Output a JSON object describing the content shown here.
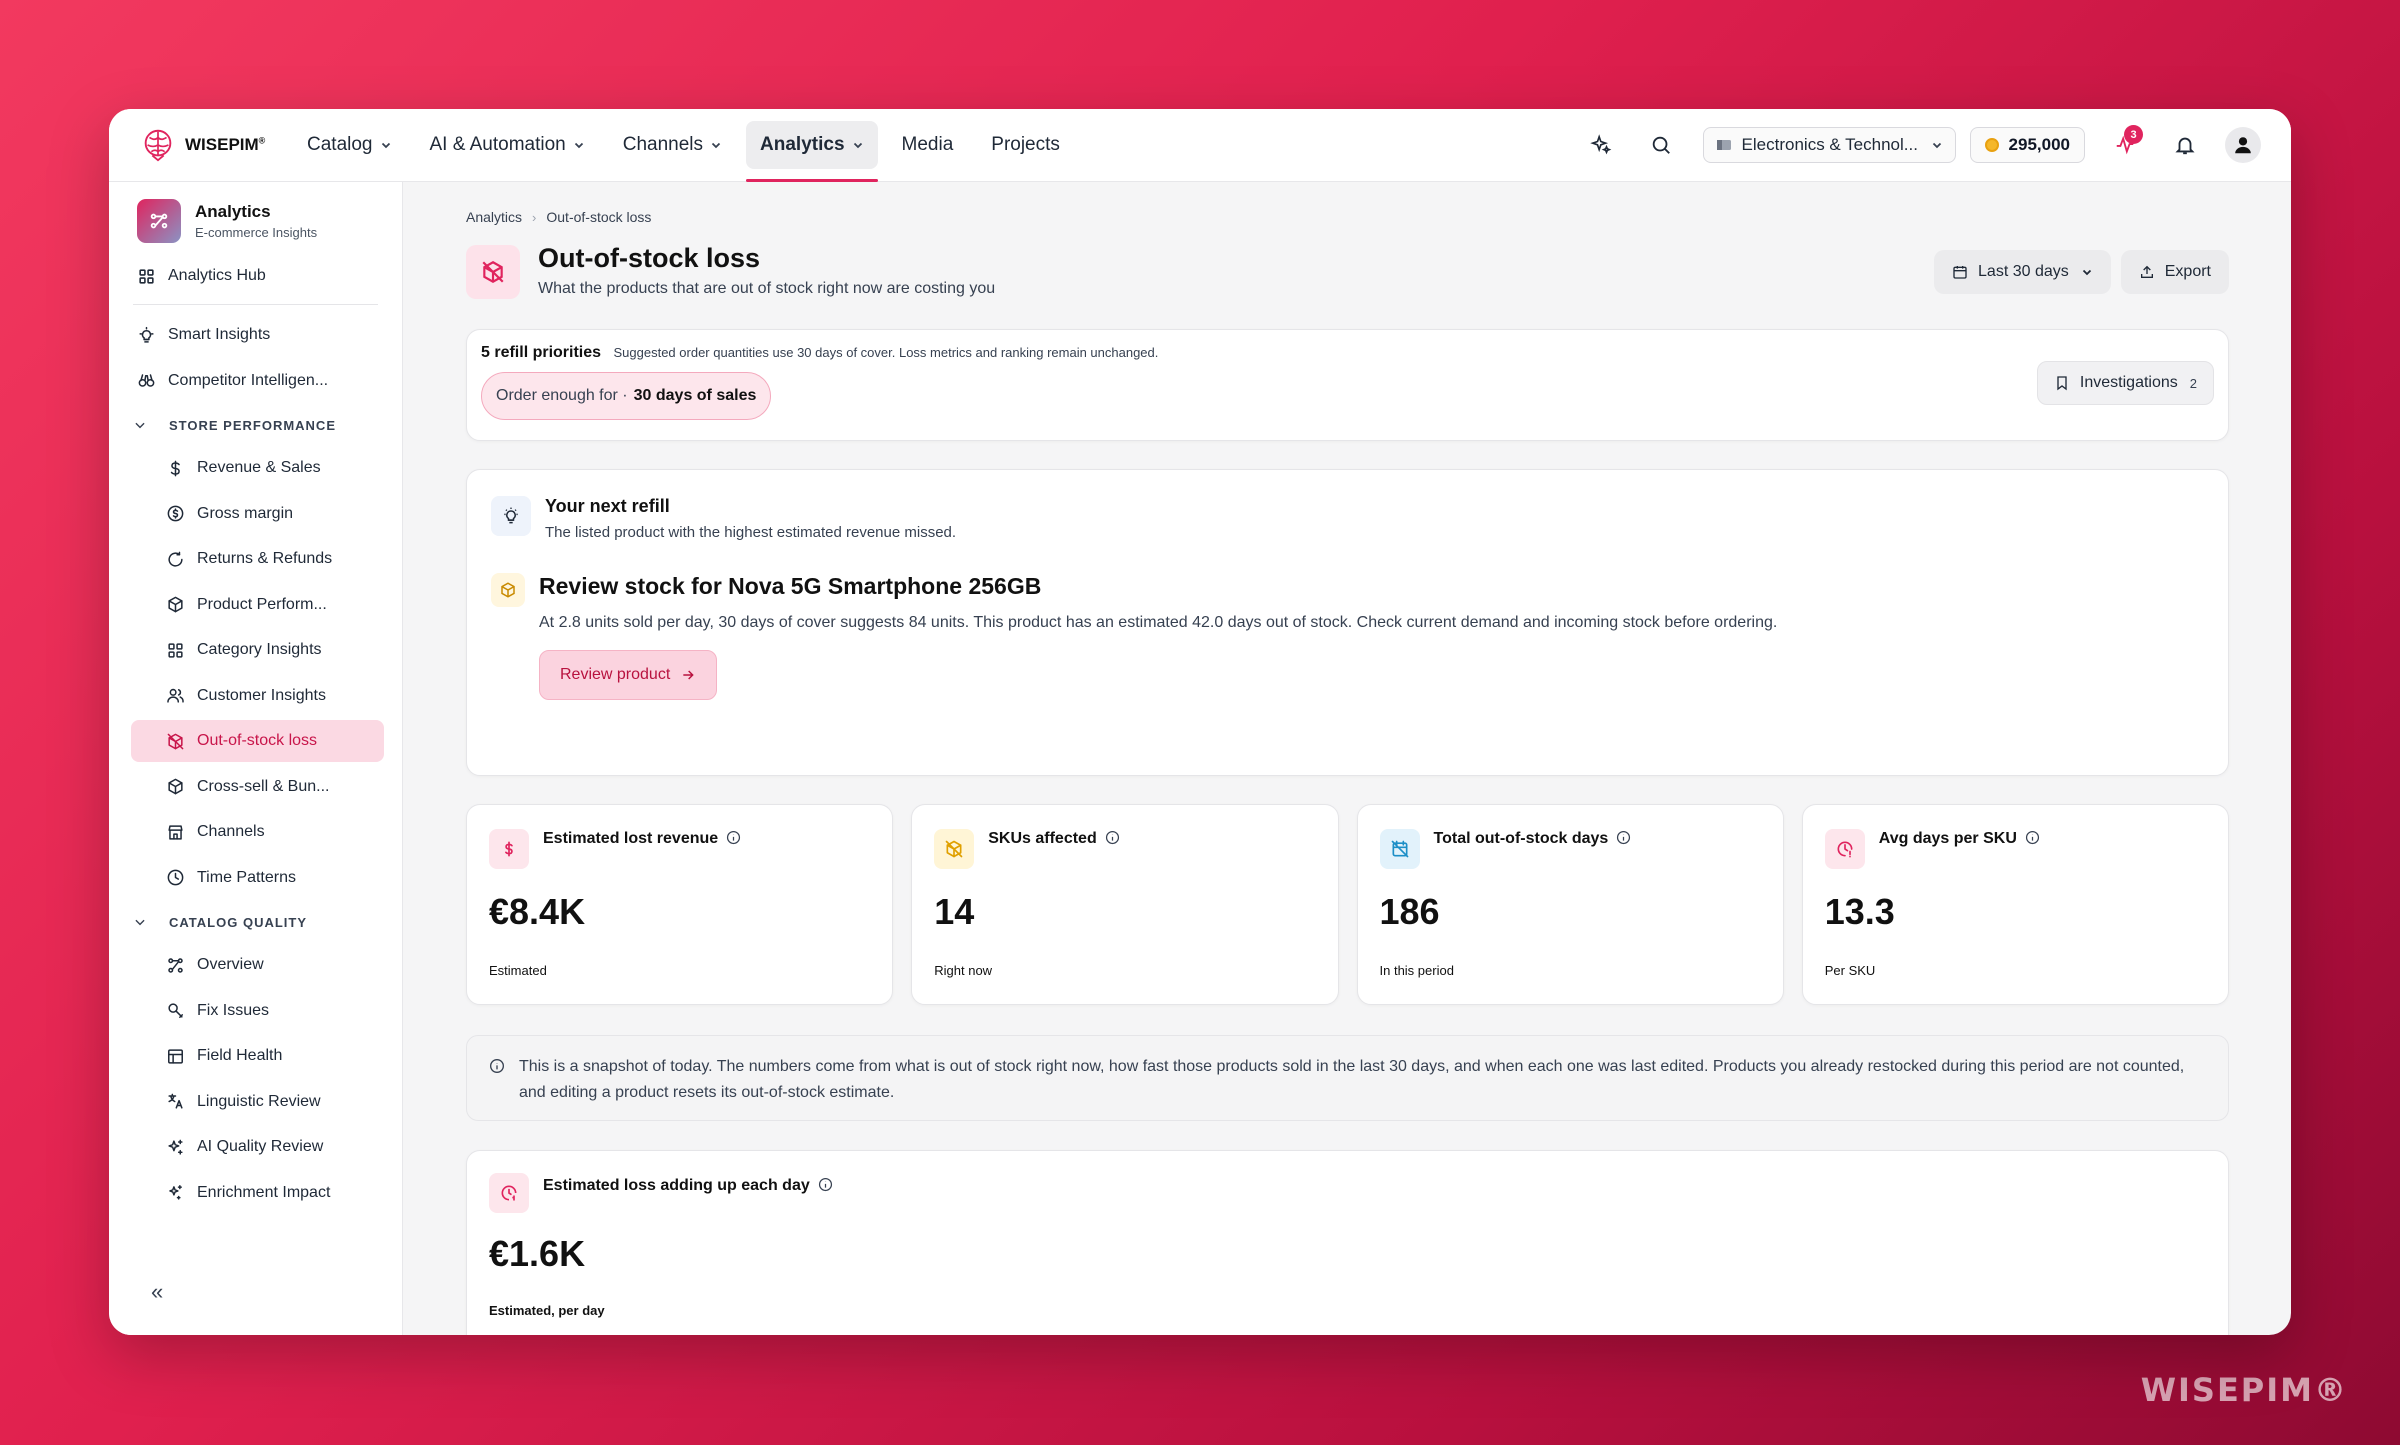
{
  "brand": {
    "name": "WISEPIM",
    "mark": "®"
  },
  "watermark": "WISEPIM®",
  "nav": {
    "items": [
      {
        "label": "Catalog",
        "dropdown": true
      },
      {
        "label": "AI & Automation",
        "dropdown": true
      },
      {
        "label": "Channels",
        "dropdown": true
      },
      {
        "label": "Analytics",
        "dropdown": true,
        "active": true
      },
      {
        "label": "Media",
        "dropdown": false
      },
      {
        "label": "Projects",
        "dropdown": false
      }
    ],
    "store": "Electronics & Technol...",
    "credits": "295,000",
    "activity_badge": "3",
    "icons": [
      "sparkle-icon",
      "search-icon",
      "activity-icon",
      "bell-icon",
      "user-icon"
    ]
  },
  "sidebar": {
    "app_title": "Analytics",
    "app_subtitle": "E-commerce Insights",
    "hub": "Analytics Hub",
    "top_items": [
      "Smart Insights",
      "Competitor Intelligen..."
    ],
    "sections": [
      {
        "title": "STORE PERFORMANCE",
        "items": [
          "Revenue & Sales",
          "Gross margin",
          "Returns & Refunds",
          "Product Perform...",
          "Category Insights",
          "Customer Insights",
          "Out-of-stock loss",
          "Cross-sell & Bun...",
          "Channels",
          "Time Patterns"
        ]
      },
      {
        "title": "CATALOG QUALITY",
        "items": [
          "Overview",
          "Fix Issues",
          "Field Health",
          "Linguistic Review",
          "AI Quality Review",
          "Enrichment Impact"
        ]
      }
    ],
    "active_item": "Out-of-stock loss",
    "collapse_label": "«"
  },
  "page": {
    "breadcrumb": [
      "Analytics",
      "Out-of-stock loss"
    ],
    "title": "Out-of-stock loss",
    "subtitle": "What the products that are out of stock right now are costing you",
    "period_button": "Last 30 days",
    "export_button": "Export"
  },
  "refill": {
    "count_label": "5 refill priorities",
    "note": "Suggested order quantities use 30 days of cover. Loss metrics and ranking remain unchanged.",
    "chip_prefix": "Order enough for ·",
    "chip_value": "30 days of sales",
    "investigations_label": "Investigations",
    "investigations_count": "2"
  },
  "next_refill": {
    "heading": "Your next refill",
    "subheading": "The listed product with the highest estimated revenue missed.",
    "title": "Review stock for Nova 5G Smartphone 256GB",
    "description": "At 2.8 units sold per day, 30 days of cover suggests 84 units. This product has an estimated 42.0 days out of stock. Check current demand and incoming stock before ordering.",
    "button": "Review product"
  },
  "kpis": [
    {
      "label": "Estimated lost revenue",
      "value": "€8.4K",
      "note": "Estimated",
      "icon": "dollar-icon",
      "color": "#e0245e",
      "bg": "#fde6ec"
    },
    {
      "label": "SKUs affected",
      "value": "14",
      "note": "Right now",
      "icon": "box-off-icon",
      "color": "#e0a000",
      "bg": "#fff5d6"
    },
    {
      "label": "Total out-of-stock days",
      "value": "186",
      "note": "In this period",
      "icon": "calendar-off-icon",
      "color": "#1d8fc7",
      "bg": "#e2f2fb"
    },
    {
      "label": "Avg days per SKU",
      "value": "13.3",
      "note": "Per SKU",
      "icon": "clock-alert-icon",
      "color": "#e0245e",
      "bg": "#fde6ec"
    }
  ],
  "snapshot_note": "This is a snapshot of today. The numbers come from what is out of stock right now, how fast those products sold in the last 30 days, and when each one was last edited. Products you already restocked during this period are not counted, and editing a product resets its out-of-stock estimate.",
  "daily_loss": {
    "label": "Estimated loss adding up each day",
    "value": "€1.6K",
    "note": "Estimated, per day"
  }
}
